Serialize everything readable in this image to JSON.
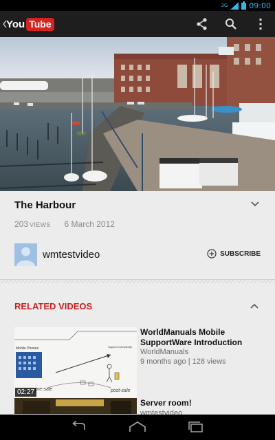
{
  "status_bar": {
    "network": "3G",
    "time": "09:00"
  },
  "action_bar": {
    "logo_you": "You",
    "logo_tube": "Tube",
    "icons": [
      "back-arrow-icon",
      "share-icon",
      "search-icon",
      "overflow-menu-icon"
    ]
  },
  "video": {
    "title": "The Harbour",
    "views_count": "203",
    "views_label": "VIEWS",
    "date": "6 March 2012"
  },
  "channel": {
    "name": "wmtestvideo",
    "subscribe_label": "SUBSCRIBE"
  },
  "related": {
    "heading": "RELATED VIDEOS",
    "items": [
      {
        "title": "WorldManuals Mobile SupportWare Introduction",
        "channel": "WorldManuals",
        "meta": "9 months ago | 128 views",
        "duration": "02:27",
        "thumb_text": [
          "Mobile Phones",
          "Support Complexity",
          "pre-sale",
          "post-sale"
        ]
      },
      {
        "title": "Server room!",
        "channel": "wmtestvideo"
      }
    ]
  },
  "nav_bar": {
    "icons": [
      "back-icon",
      "home-icon",
      "recent-apps-icon"
    ]
  },
  "colors": {
    "accent_red": "#cc1f1f",
    "status_blue": "#33b5e5",
    "logo_red": "#d32323"
  }
}
